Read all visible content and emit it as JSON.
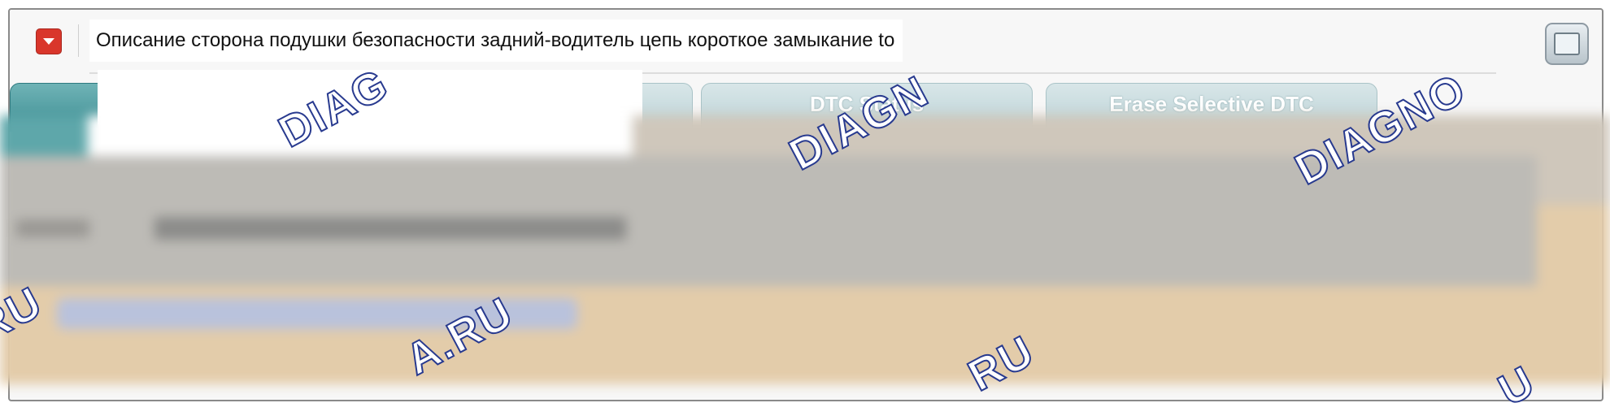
{
  "window": {
    "title": "Описание сторона подушки безопасности задний-водитель цепь короткое замыкание to",
    "menu_icon": "chevron-down-icon",
    "maximize_icon": "maximize-icon"
  },
  "tabs": [
    {
      "label": ""
    },
    {
      "label": ""
    },
    {
      "label": "DTC Status"
    },
    {
      "label": "Erase Selective DTC"
    }
  ],
  "watermarks": [
    {
      "text": "DIAG"
    },
    {
      "text": "DIAGN"
    },
    {
      "text": "DIAGNO"
    },
    {
      "text": "RU"
    },
    {
      "text": "A.RU"
    },
    {
      "text": "RU"
    },
    {
      "text": "U"
    }
  ],
  "colors": {
    "menu_button": "#d9362b",
    "tab_active": "#3f8f94",
    "tab_inactive": "#bcd3d7",
    "watermark_stroke": "#283a8f",
    "content_background": "#e3ccaa"
  }
}
